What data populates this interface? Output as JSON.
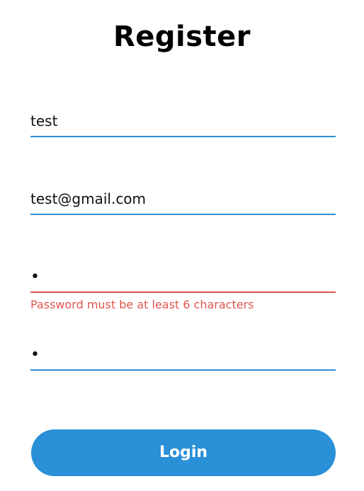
{
  "title": "Register",
  "fields": {
    "username": {
      "value": "test"
    },
    "email": {
      "value": "test@gmail.com"
    },
    "password": {
      "value": "x"
    },
    "confirm_password": {
      "value": "x"
    }
  },
  "errors": {
    "password": "Password must be at least 6 characters"
  },
  "submit": {
    "label": "Login"
  },
  "colors": {
    "accent": "#2a90d8",
    "underline": "#2d8fd4",
    "error": "#e0554e"
  }
}
